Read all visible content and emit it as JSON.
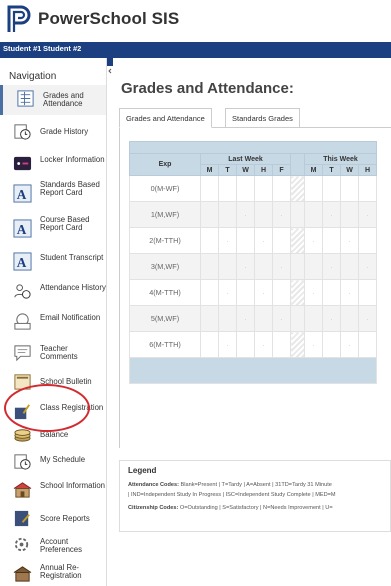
{
  "app": {
    "title": "PowerSchool SIS"
  },
  "student_tabs": [
    "Student #1",
    "Student #2"
  ],
  "sidebar": {
    "title": "Navigation",
    "items": [
      {
        "label": "Grades and Attendance",
        "icon": "grades-icon"
      },
      {
        "label": "Grade History",
        "icon": "history-clock-icon"
      },
      {
        "label": "Locker Information",
        "icon": "locker-icon"
      },
      {
        "label": "Standards Based Report Card",
        "icon": "report-card-icon"
      },
      {
        "label": "Course Based Report Card",
        "icon": "report-card-icon"
      },
      {
        "label": "Student Transcript",
        "icon": "transcript-icon"
      },
      {
        "label": "Attendance History",
        "icon": "attendance-history-icon"
      },
      {
        "label": "Email Notification",
        "icon": "email-icon"
      },
      {
        "label": "Teacher Comments",
        "icon": "comments-icon"
      },
      {
        "label": "School Bulletin",
        "icon": "bulletin-icon"
      },
      {
        "label": "Class Registration",
        "icon": "class-registration-icon"
      },
      {
        "label": "Balance",
        "icon": "balance-coins-icon"
      },
      {
        "label": "My Schedule",
        "icon": "schedule-icon"
      },
      {
        "label": "School Information",
        "icon": "school-icon"
      },
      {
        "label": "Score Reports",
        "icon": "score-reports-icon"
      },
      {
        "label": "Account Preferences",
        "icon": "account-preferences-icon"
      },
      {
        "label": "Annual Re-Registration",
        "icon": "re-registration-icon"
      }
    ]
  },
  "main": {
    "title": "Grades and Attendance:",
    "tabs": [
      "Grades and Attendance",
      "Standards Grades"
    ],
    "table": {
      "exp_header": "Exp",
      "week_headers": [
        "Last Week",
        "This Week"
      ],
      "day_headers": [
        "M",
        "T",
        "W",
        "H",
        "F",
        "M",
        "T",
        "W",
        "H"
      ],
      "rows": [
        "0(M-WF)",
        "1(M,WF)",
        "2(M-TTH)",
        "3(M,WF)",
        "4(M-TTH)",
        "5(M,WF)",
        "6(M-TTH)"
      ],
      "empty_mark": "."
    },
    "legend": {
      "title": "Legend",
      "attendance_label": "Attendance Codes:",
      "attendance_text": "Blank=Present | T=Tardy | A=Absent | 31TD=Tardy 31 Minute",
      "attendance_text2": "| IND=Independent Study In Progress | ISC=Independent Study Complete | MED=M",
      "citizenship_label": "Citizenship Codes:",
      "citizenship_text": "O=Outstanding | S=Satisfactory | N=Needs Improvement | U="
    }
  },
  "colors": {
    "brand": "#1b3f80",
    "table_header": "#c8d9e6",
    "annotation": "#d22a30"
  }
}
